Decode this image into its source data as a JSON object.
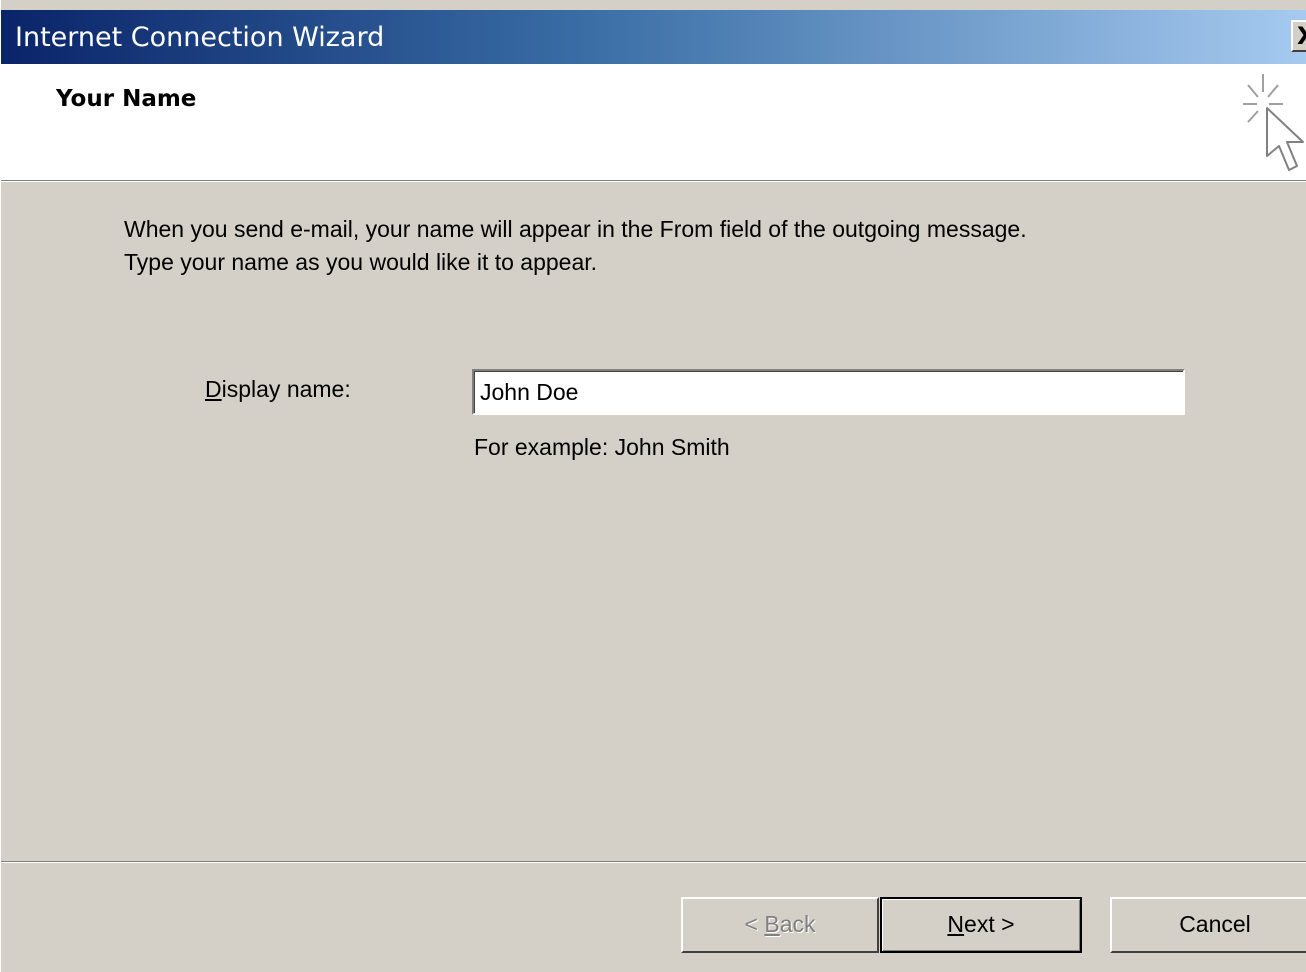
{
  "window": {
    "title": "Internet Connection Wizard",
    "close_label": "X"
  },
  "header": {
    "title": "Your Name",
    "icon": "wizard-cursor-sparkle-icon"
  },
  "intro": {
    "line1": "When you send e-mail, your name will appear in the From field of the outgoing message.",
    "line2": "Type your name as you would like it to appear."
  },
  "form": {
    "display_name_label_accel": "D",
    "display_name_label_rest": "isplay name:",
    "display_name_value": "John Doe",
    "example_text": "For example: John Smith"
  },
  "buttons": {
    "back_prefix": "< ",
    "back_accel": "B",
    "back_rest": "ack",
    "next_accel": "N",
    "next_rest": "ext >",
    "cancel": "Cancel"
  },
  "colors": {
    "titlebar_start": "#0a246a",
    "titlebar_end": "#a6caf0",
    "dialog_bg": "#d4d0c8",
    "header_bg": "#ffffff",
    "disabled_text": "#808080"
  }
}
